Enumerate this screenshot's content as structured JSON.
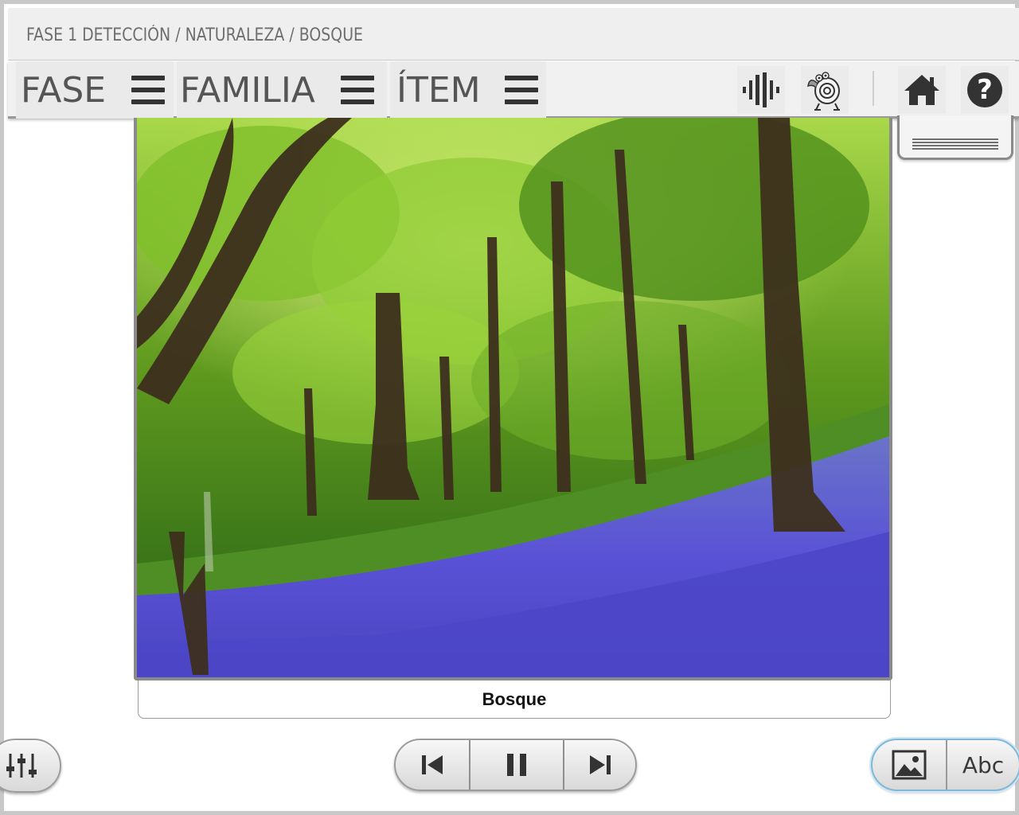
{
  "breadcrumb": "FASE 1 DETECCIÓN / NATURALEZA / BOSQUE",
  "nav": {
    "phase_label": "FASE",
    "family_label": "FAMILIA",
    "item_label": "ÍTEM"
  },
  "toolbar": {
    "icons": [
      "sound-bars-icon",
      "mascot-icon",
      "home-icon",
      "help-icon"
    ],
    "help_glyph": "?"
  },
  "image": {
    "caption": "Bosque",
    "icon": "forest-photo"
  },
  "player": {
    "icons": [
      "previous-icon",
      "pause-icon",
      "next-icon"
    ]
  },
  "mode": {
    "image_icon": "picture-icon",
    "text_label": "Abc",
    "active": "image"
  },
  "colors": {
    "bar_bg": "#efefef",
    "text_gray": "#6e6e6e",
    "icon_dark": "#333333",
    "active_outline": "#7fb8d8"
  }
}
